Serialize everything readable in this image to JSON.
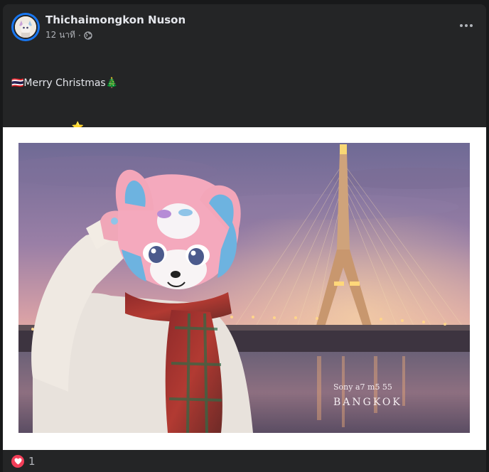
{
  "post": {
    "author": "Thichaimongkon Nuson",
    "timestamp": "12 นาที",
    "privacy_icon": "globe-icon",
    "more_icon": "more-options-icon",
    "text_lines": [
      "🇹🇭Merry Christmas🎄",
      ".                  ⭐",
      ".                  🎄",
      "🌼🌳☘️🌱☘️🌳🌼",
      ".                  👿"
    ]
  },
  "photo": {
    "caption_camera": "Sony a7 m5 55",
    "caption_city": "BANGKOK"
  },
  "reactions": {
    "icon": "love-reaction-icon",
    "count": "1"
  },
  "colors": {
    "card_bg": "#242526",
    "text": "#e4e6eb",
    "secondary_text": "#b0b3b8",
    "avatar_ring": "#1877f2",
    "love": "#f33e58"
  }
}
